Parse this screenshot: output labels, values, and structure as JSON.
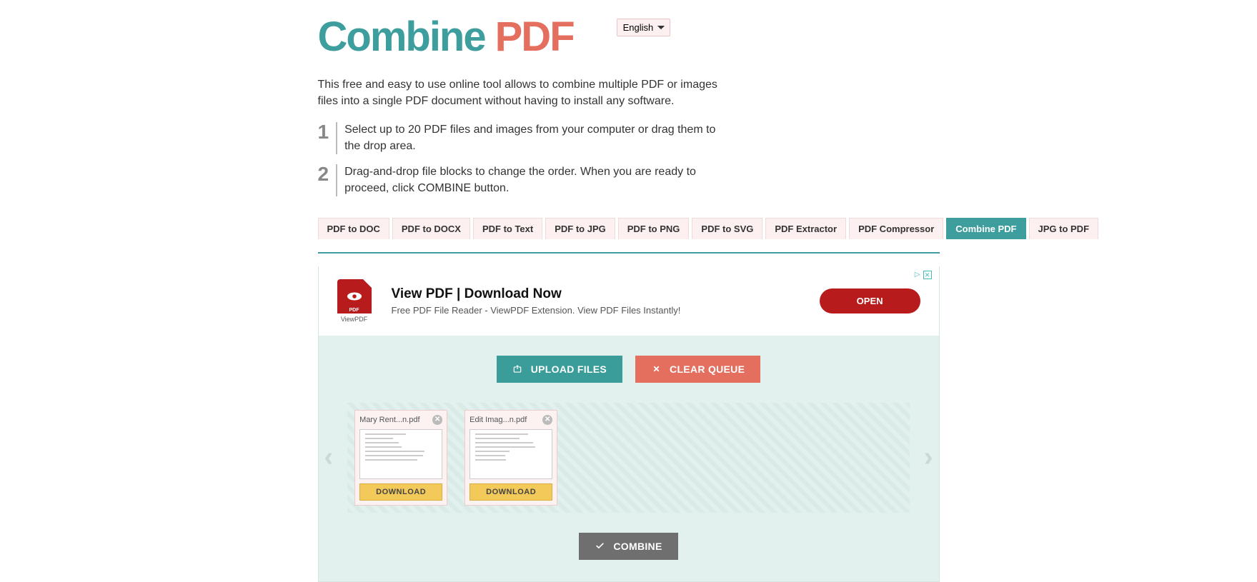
{
  "logo": {
    "word1": "Combine",
    "word2": "PDF"
  },
  "language": {
    "selected": "English",
    "options": [
      "English"
    ]
  },
  "intro": "This free and easy to use online tool allows to combine multiple PDF or images files into a single PDF document without having to install any software.",
  "steps": [
    {
      "num": "1",
      "text": "Select up to 20 PDF files and images from your computer or drag them to the drop area."
    },
    {
      "num": "2",
      "text": "Drag-and-drop file blocks to change the order. When you are ready to proceed, click COMBINE button."
    }
  ],
  "tabs": [
    "PDF to DOC",
    "PDF to DOCX",
    "PDF to Text",
    "PDF to JPG",
    "PDF to PNG",
    "PDF to SVG",
    "PDF Extractor",
    "PDF Compressor",
    "Combine PDF",
    "JPG to PDF"
  ],
  "active_tab": 8,
  "ad": {
    "icon_text": "PDF",
    "icon_sub": "ViewPDF",
    "title": "View PDF | Download Now",
    "subtitle": "Free PDF File Reader - ViewPDF Extension. View PDF Files Instantly!",
    "cta": "OPEN",
    "info_icon": "▷"
  },
  "buttons": {
    "upload": "UPLOAD FILES",
    "clear": "CLEAR QUEUE",
    "combine": "COMBINE",
    "download": "DOWNLOAD"
  },
  "files": [
    {
      "name": "Mary Rent...n.pdf"
    },
    {
      "name": "Edit Imag...n.pdf"
    }
  ],
  "arrows": {
    "left": "‹",
    "right": "›"
  }
}
